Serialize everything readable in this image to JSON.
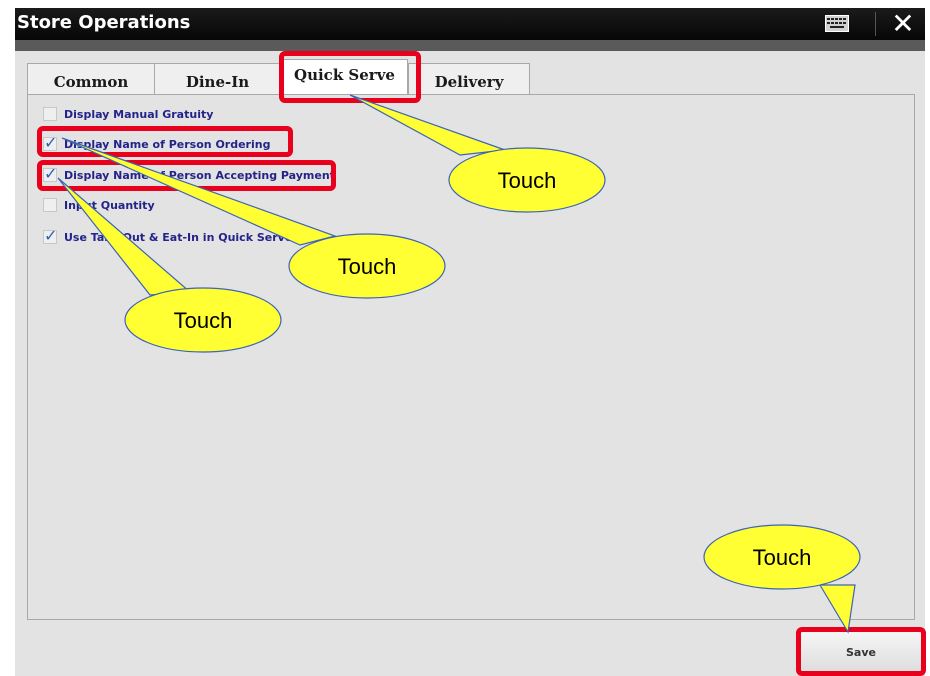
{
  "window": {
    "title": "Store Operations",
    "keyboard_icon": "keyboard-icon",
    "close_icon": "close-icon",
    "close_glyph": "✕"
  },
  "tabs": [
    {
      "label": "Common"
    },
    {
      "label": "Dine-In"
    },
    {
      "label": "Quick Serve",
      "active": true
    },
    {
      "label": "Delivery"
    }
  ],
  "options": [
    {
      "label": "Display Manual Gratuity",
      "checked": false
    },
    {
      "label": "Display Name of Person Ordering",
      "checked": true
    },
    {
      "label": "Display Name of Person Accepting Payment",
      "checked": true
    },
    {
      "label": "Input Quantity",
      "checked": false
    },
    {
      "label": "Use Take Out & Eat-In in Quick Serve",
      "checked": true
    }
  ],
  "check_glyph": "✓",
  "save_label": "Save",
  "callouts": [
    {
      "text": "Touch"
    },
    {
      "text": "Touch"
    },
    {
      "text": "Touch"
    },
    {
      "text": "Touch"
    }
  ],
  "colors": {
    "highlight": "#e8001c",
    "callout_fill": "#ffff33",
    "callout_stroke": "#3c64b4",
    "option_text": "#23238a",
    "check": "#2a5fb5"
  }
}
